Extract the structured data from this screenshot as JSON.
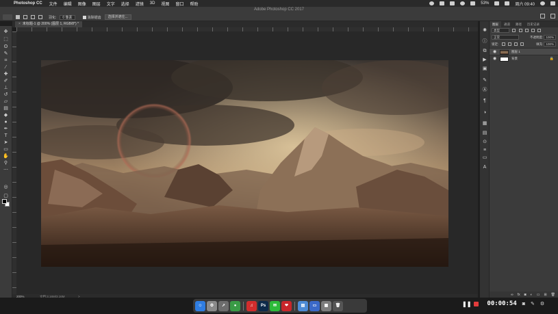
{
  "menubar": {
    "app_name": "Photoshop CC",
    "items": [
      "文件",
      "编辑",
      "图像",
      "图层",
      "文字",
      "选择",
      "滤镜",
      "3D",
      "视图",
      "窗口",
      "帮助"
    ],
    "battery": "53%",
    "clock": "周六 09:40"
  },
  "window": {
    "title": "Adobe Photoshop CC 2017"
  },
  "options": {
    "feather_label": "羽化:",
    "feather_value": "0 像素",
    "antialias_label": "消除锯齿",
    "select_mask_label": "选择并遮住..."
  },
  "document": {
    "tab_label": "未标题-1 @ 200% (图层 1, RGB/8*) *"
  },
  "status": {
    "zoom": "200%",
    "doc_info": "文档:3.16M/3.16M",
    "chevron": ">"
  },
  "panels": {
    "tabs": [
      "图层",
      "通道",
      "路径",
      "历史记录"
    ],
    "kind_label": "类型",
    "blend_mode": "正常",
    "opacity_label": "不透明度:",
    "opacity_value": "100%",
    "lock_label": "锁定:",
    "fill_label": "填充:",
    "fill_value": "100%",
    "layers": [
      {
        "name": "图层 1",
        "selected": true
      },
      {
        "name": "背景",
        "selected": false
      }
    ]
  },
  "dock": {
    "apps": [
      {
        "name": "finder",
        "glyph": "☺",
        "color": "#2f7de1"
      },
      {
        "name": "system-preferences",
        "glyph": "⚙",
        "color": "#8a8a8a"
      },
      {
        "name": "launchpad",
        "glyph": "➚",
        "color": "#6d6d6d"
      },
      {
        "name": "chrome",
        "glyph": "●",
        "color": "#3a9b46"
      },
      {
        "name": "netease-music",
        "glyph": "♫",
        "color": "#d22d2d"
      },
      {
        "name": "photoshop",
        "glyph": "Ps",
        "color": "#0d2a4a"
      },
      {
        "name": "wechat",
        "glyph": "✉",
        "color": "#2dbb3a"
      },
      {
        "name": "gift-app",
        "glyph": "❤",
        "color": "#c9262b"
      },
      {
        "name": "folder",
        "glyph": "▤",
        "color": "#4d8bd6"
      },
      {
        "name": "keynote",
        "glyph": "▭",
        "color": "#3b69c8"
      },
      {
        "name": "screenshot",
        "glyph": "▦",
        "color": "#7d7d7d"
      },
      {
        "name": "trash",
        "glyph": "🗑",
        "color": "#555"
      }
    ]
  },
  "recorder": {
    "timer": "00:00:54"
  }
}
